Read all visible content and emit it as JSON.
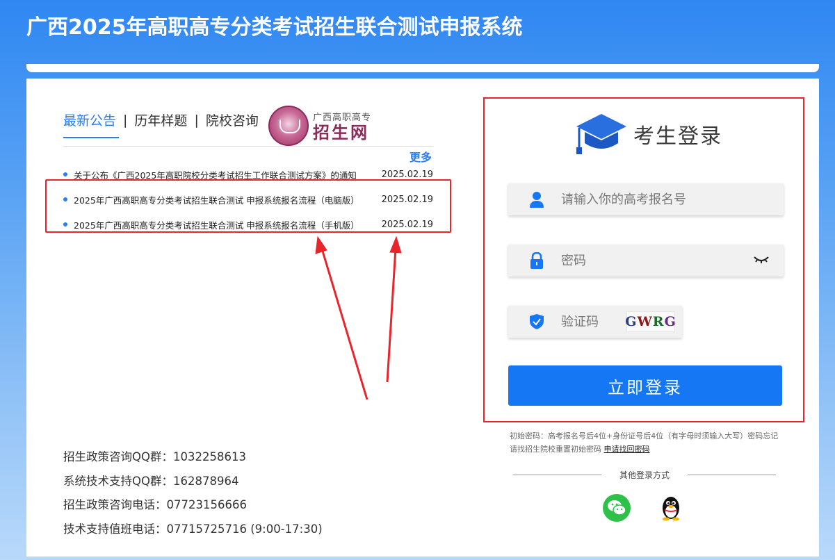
{
  "header": {
    "title": "广西2025年高职高专分类考试招生联合测试申报系统"
  },
  "tabs": [
    {
      "label": "最新公告",
      "active": true
    },
    {
      "label": "历年样题",
      "active": false
    },
    {
      "label": "院校咨询",
      "active": false
    }
  ],
  "tab_separator": "|",
  "logo": {
    "small": "广西高职高专",
    "big": "招生网"
  },
  "more_label": "更多",
  "news": [
    {
      "title": "关于公布《广西2025年高职院校分类考试招生工作联合测试方案》的通知",
      "date": "2025.02.19"
    },
    {
      "title": "2025年广西高职高专分类考试招生联合测试 申报系统报名流程（电脑版）",
      "date": "2025.02.19"
    },
    {
      "title": "2025年广西高职高专分类考试招生联合测试 申报系统报名流程（手机版）",
      "date": "2025.02.19"
    }
  ],
  "contacts": [
    "招生政策咨询QQ群：1032258613",
    "系统技术支持QQ群：162878964",
    "招生政策咨询电话：07723156666",
    "技术支持值班电话：07715725716 (9:00-17:30)"
  ],
  "login": {
    "title": "考生登录",
    "username_placeholder": "请输入你的高考报名号",
    "password_placeholder": "密码",
    "captcha_placeholder": "验证码",
    "captcha_chars": [
      "G",
      "W",
      "R",
      "G"
    ],
    "submit_label": "立即登录",
    "hint_text": "初始密码：高考报名号后4位+身份证号后4位（有字母时须输入大写）密码忘记请找招生院校重置初始密码",
    "hint_link": "申请找回密码",
    "other_label": "其他登录方式"
  },
  "colors": {
    "accent": "#1677f5",
    "highlight": "#e8252a",
    "wechat": "#2dc14a"
  }
}
